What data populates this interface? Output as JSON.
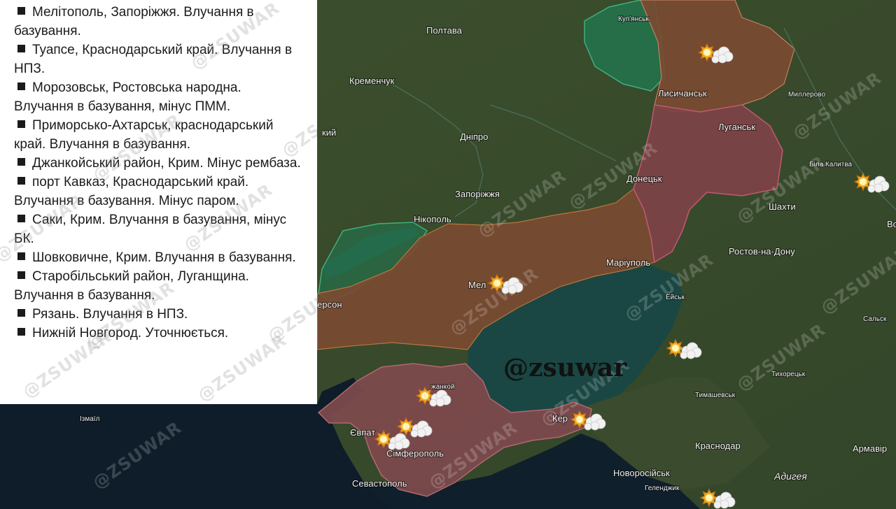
{
  "strikes_list": [
    "Мелітополь, Запоріжжя. Влучання в базування.",
    "Туапсе, Краснодарський край. Влучання в НПЗ.",
    "Морозовськ, Ростовська народна. Влучання в базування, мінус ПММ.",
    "Приморсько-Ахтарськ, краснодарський край. Влучання в базування.",
    "Джанкойський район, Крим. Мінус рембаза.",
    "порт Кавказ, Краснодарський край. Влучання в базування. Мінус паром.",
    "Саки, Крим. Влучання в базування, мінус БК.",
    "Шовковичне, Крим. Влучання в базування.",
    "Старобільський район, Луганщина. Влучання в базування.",
    "Рязань. Влучання в НПЗ.",
    "Нижній Новгород. Уточнюється."
  ],
  "watermark": "@zsuwar",
  "watermark_faint": "@ZSUWAR",
  "cities": {
    "poltava": "Полтава",
    "kupiansk": "Куп'янськ",
    "kremenchuk": "Кременчук",
    "lysychansk": "Лисичанськ",
    "millerovo": "Миллерово",
    "luhansk": "Луганськ",
    "kyi": "кий",
    "dnipro": "Дніпро",
    "bila_kalytva": "Біла Калитва",
    "donetsk": "Донецьк",
    "zaporizhzhia": "Запоріжжя",
    "shakhty": "Шахти",
    "bo": "Во",
    "nikopol": "Нікополь",
    "rostov": "Ростов-на-Дону",
    "mariupol": "Маріуполь",
    "mel": "Мел",
    "yeisk": "Ейськ",
    "kherson": "ерсон",
    "salsk": "Сальск",
    "tykhoretsk": "Тихорецьк",
    "dzhankoi": "жанкой",
    "tymashevsk": "Тимашевськ",
    "izmail": "Ізмаїл",
    "yevpatoria": "Євпат",
    "kerch": "Кер",
    "krasnodar": "Краснодар",
    "armavir": "Армавір",
    "simferopol": "Сімферополь",
    "novorossiysk": "Новоросійськ",
    "gelendzhik": "Геленджик",
    "adygea": "Адигея",
    "sevastopol": "Севастополь"
  },
  "colors": {
    "occupied": "#7a4a32",
    "luhansk_donetsk": "#7e4246",
    "crimea": "#7c4a4c",
    "liberated": "#1f7a52",
    "sea": "#153a3a",
    "land": "#3a4a2e",
    "panel_bg": "#ffffff",
    "panel_text": "#1b1b1b"
  }
}
